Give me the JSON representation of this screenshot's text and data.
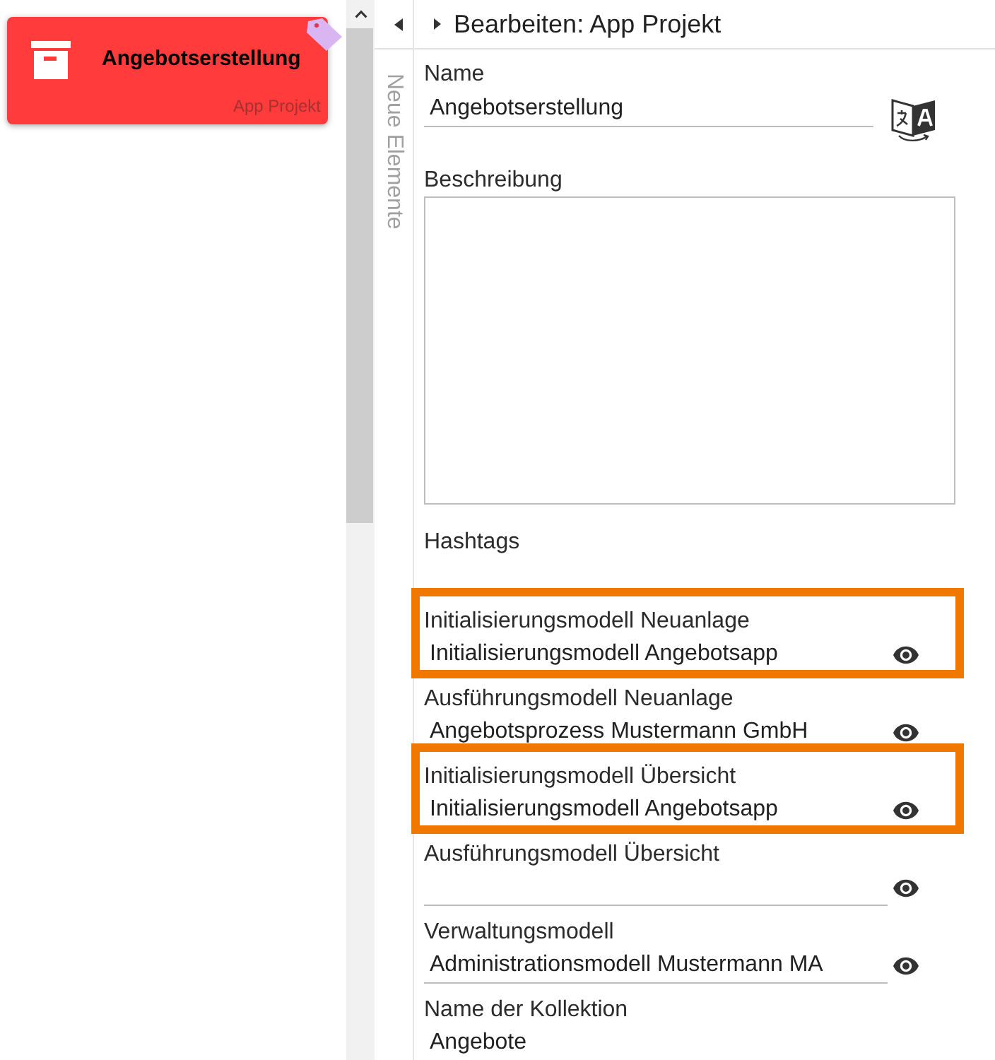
{
  "card": {
    "title": "Angebotserstellung",
    "subtitle": "App Projekt"
  },
  "side_panel": {
    "label": "Neue Elemente"
  },
  "editor": {
    "title": "Bearbeiten: App Projekt"
  },
  "name_field": {
    "label": "Name",
    "value": "Angebotserstellung"
  },
  "description_field": {
    "label": "Beschreibung"
  },
  "hashtags": {
    "label": "Hashtags"
  },
  "model_fields": [
    {
      "label": "Initialisierungsmodell Neuanlage",
      "value": "Initialisierungsmodell Angebotsapp",
      "highlighted": true
    },
    {
      "label": "Ausführungsmodell Neuanlage",
      "value": "Angebotsprozess Mustermann GmbH",
      "highlighted": false
    },
    {
      "label": "Initialisierungsmodell Übersicht",
      "value": "Initialisierungsmodell Angebotsapp",
      "highlighted": true
    },
    {
      "label": "Ausführungsmodell Übersicht",
      "highlighted": false
    },
    {
      "label": "Verwaltungsmodell",
      "value": "Administrationsmodell Mustermann MA",
      "highlighted": false
    }
  ],
  "collection_field": {
    "label": "Name der Kollektion",
    "value": "Angebote"
  }
}
